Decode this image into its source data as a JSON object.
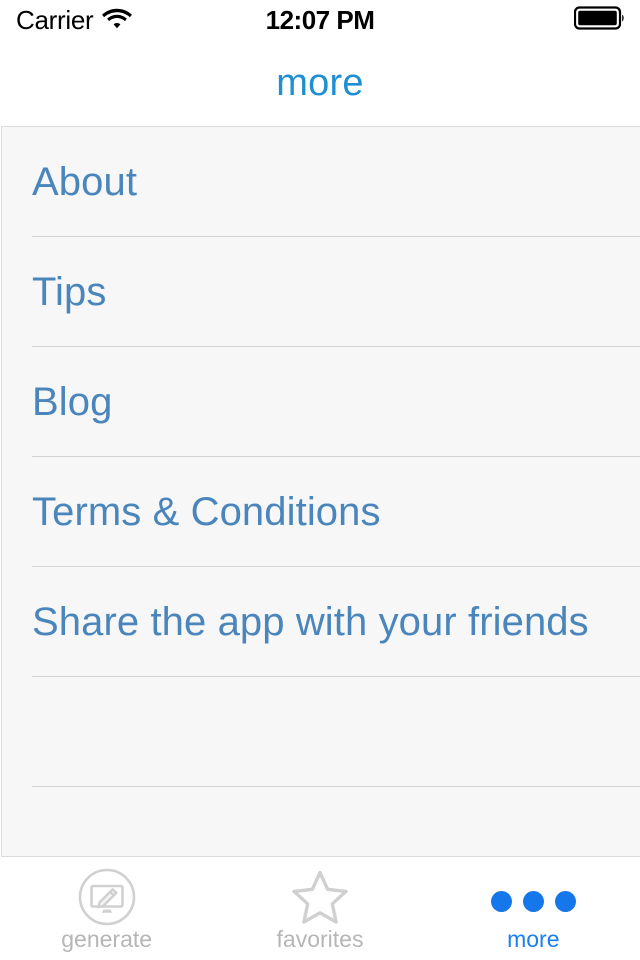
{
  "status_bar": {
    "carrier": "Carrier",
    "wifi_icon": "wifi-icon",
    "time": "12:07 PM",
    "battery_icon": "battery-full-icon"
  },
  "nav": {
    "title": "more"
  },
  "list": {
    "rows": [
      {
        "label": "About"
      },
      {
        "label": "Tips"
      },
      {
        "label": "Blog"
      },
      {
        "label": "Terms & Conditions"
      },
      {
        "label": "Share the app with your friends"
      },
      {
        "label": ""
      },
      {
        "label": ""
      }
    ]
  },
  "tab_bar": {
    "tabs": [
      {
        "label": "generate",
        "icon": "monitor-pencil-circle-icon",
        "active": false
      },
      {
        "label": "favorites",
        "icon": "star-outline-icon",
        "active": false
      },
      {
        "label": "more",
        "icon": "three-dots-icon",
        "active": true
      }
    ]
  },
  "colors": {
    "nav_title_blue": "#1e8fd2",
    "row_label_blue": "#4a86bc",
    "active_tab_blue": "#1b7ff0",
    "dots_blue": "#1577ea",
    "inactive_tab_gray": "#b6b6b6",
    "list_background": "#f7f7f7",
    "separator": "#d3d3d3"
  }
}
